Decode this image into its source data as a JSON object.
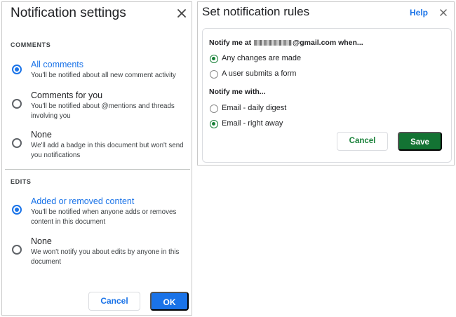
{
  "notification_settings": {
    "title": "Notification settings",
    "close_icon": "close-icon",
    "comments": {
      "section_label": "COMMENTS",
      "options": [
        {
          "title": "All comments",
          "description": "You'll be notified about all new comment activity",
          "selected": true
        },
        {
          "title": "Comments for you",
          "description": "You'll be notified about @mentions and threads involving you",
          "selected": false
        },
        {
          "title": "None",
          "description": "We'll add a badge in this document but won't send you notifications",
          "selected": false
        }
      ]
    },
    "edits": {
      "section_label": "EDITS",
      "options": [
        {
          "title": "Added or removed content",
          "description": "You'll be notified when anyone adds or removes content in this document",
          "selected": true
        },
        {
          "title": "None",
          "description": "We won't notify you about edits by anyone in this document",
          "selected": false
        }
      ]
    },
    "cancel_label": "Cancel",
    "ok_label": "OK",
    "accent_color": "#1a73e8"
  },
  "notification_rules": {
    "title": "Set notification rules",
    "help_label": "Help",
    "close_icon": "close-icon",
    "notify_when": {
      "prefix": "Notify me at",
      "email_suffix": "@gmail.com when...",
      "options": [
        {
          "label": "Any changes are made",
          "selected": true
        },
        {
          "label": "A user submits a form",
          "selected": false
        }
      ]
    },
    "notify_with": {
      "heading": "Notify me with...",
      "options": [
        {
          "label": "Email - daily digest",
          "selected": false
        },
        {
          "label": "Email - right away",
          "selected": true
        }
      ]
    },
    "cancel_label": "Cancel",
    "save_label": "Save",
    "accent_color": "#188038"
  }
}
